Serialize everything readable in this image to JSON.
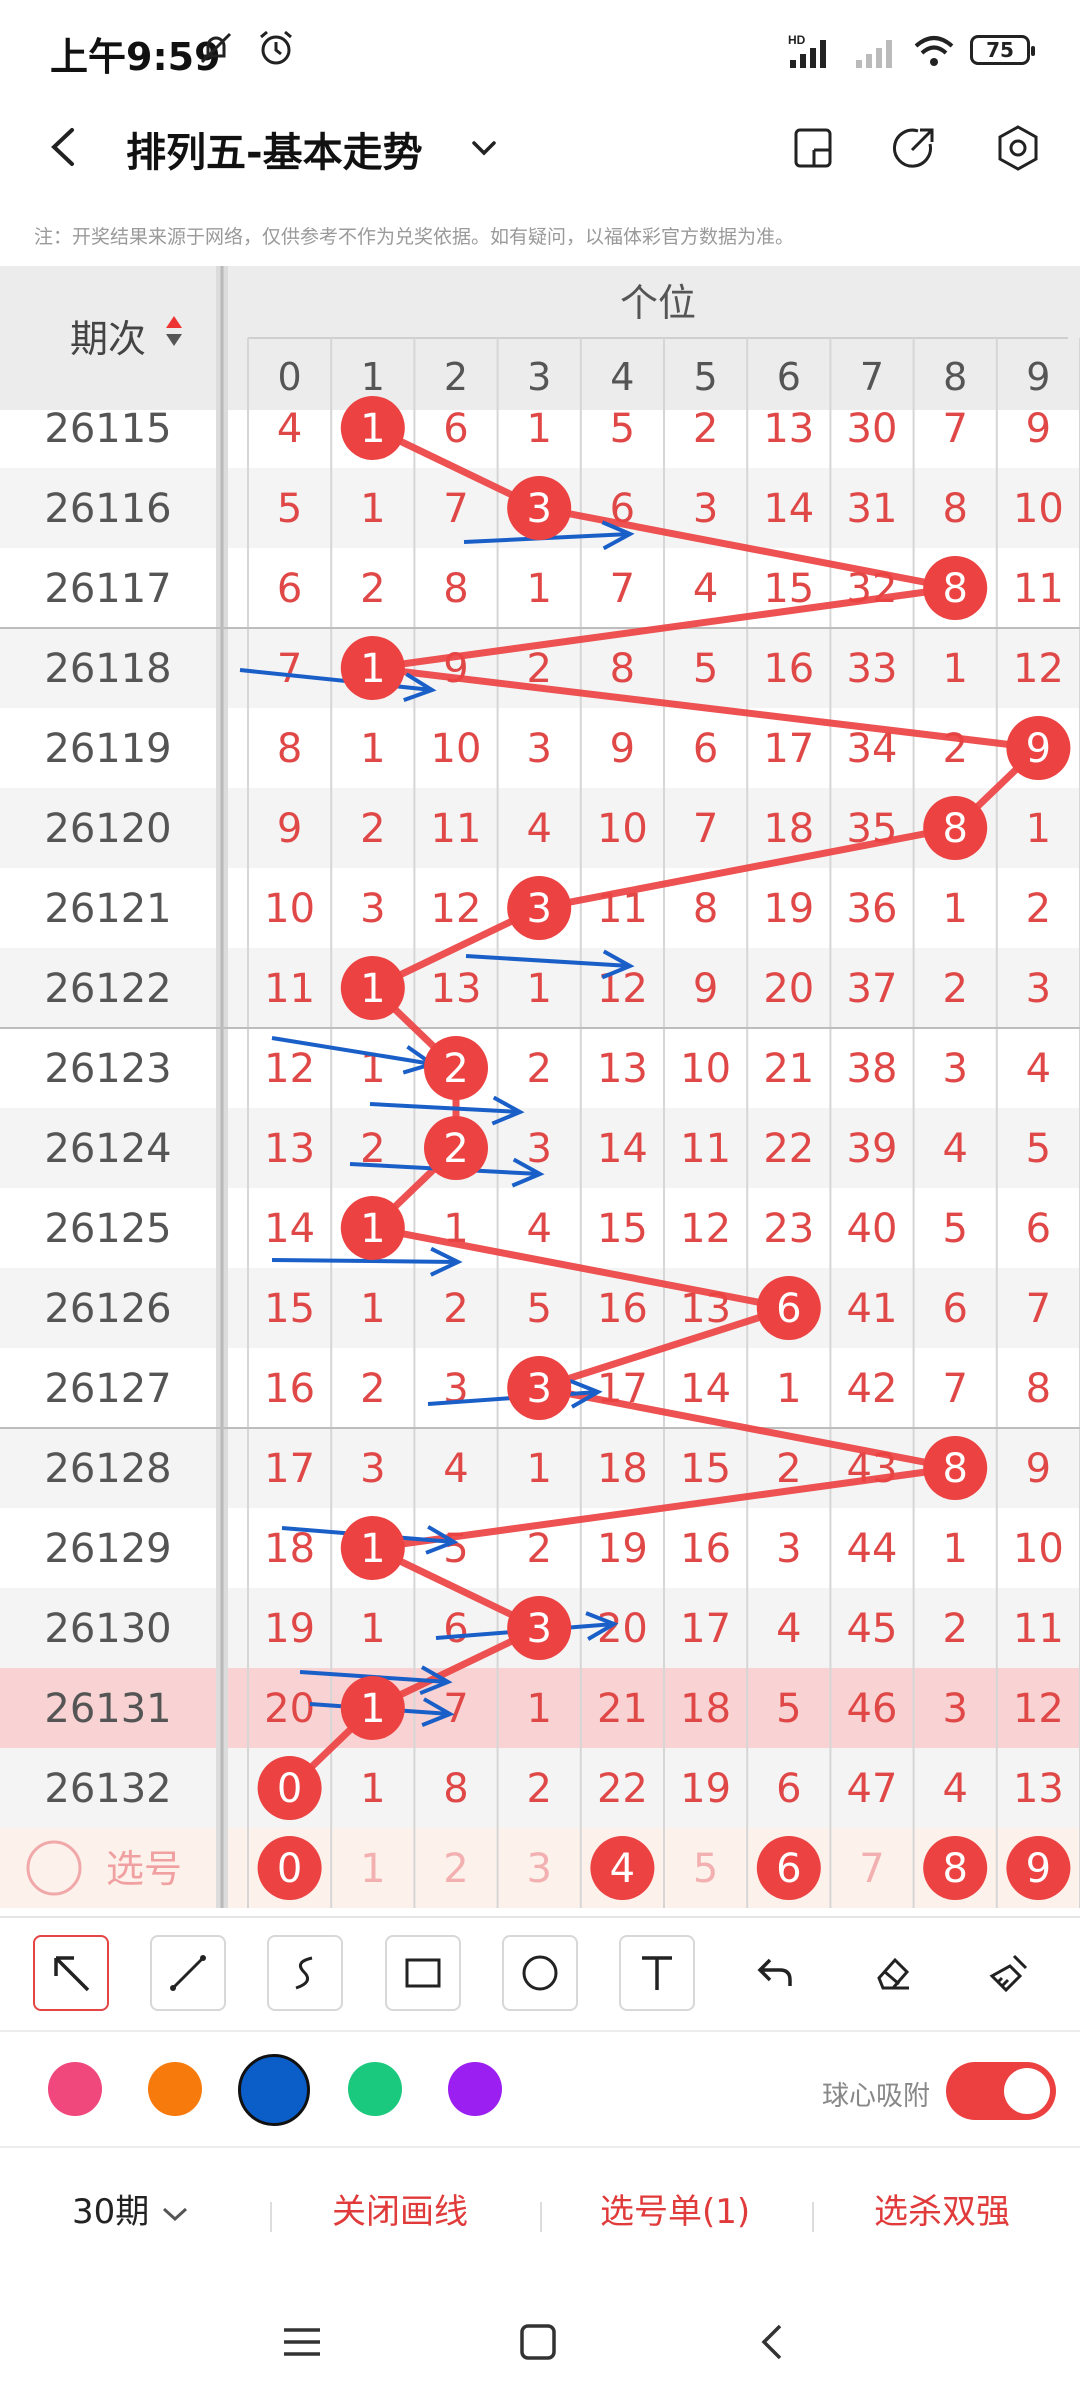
{
  "status": {
    "time": "上午9:59",
    "battery": "75",
    "network_label": "HD"
  },
  "header": {
    "title": "排列五-基本走势"
  },
  "note": "注：开奖结果来源于网络，仅供参考不作为兑奖依据。如有疑问，以福体彩官方数据为准。",
  "table": {
    "period_header": "期次",
    "group_header": "个位",
    "digit_headers": [
      "0",
      "1",
      "2",
      "3",
      "4",
      "5",
      "6",
      "7",
      "8",
      "9"
    ],
    "rows": [
      {
        "period": "26115",
        "cells": [
          "4",
          "1",
          "6",
          "1",
          "5",
          "2",
          "13",
          "30",
          "7",
          "9"
        ],
        "hit": 1
      },
      {
        "period": "26116",
        "cells": [
          "5",
          "1",
          "7",
          "3",
          "6",
          "3",
          "14",
          "31",
          "8",
          "10"
        ],
        "hit": 3
      },
      {
        "period": "26117",
        "cells": [
          "6",
          "2",
          "8",
          "1",
          "7",
          "4",
          "15",
          "32",
          "8",
          "11"
        ],
        "hit": 8
      },
      {
        "period": "26118",
        "cells": [
          "7",
          "1",
          "9",
          "2",
          "8",
          "5",
          "16",
          "33",
          "1",
          "12"
        ],
        "hit": 1
      },
      {
        "period": "26119",
        "cells": [
          "8",
          "1",
          "10",
          "3",
          "9",
          "6",
          "17",
          "34",
          "2",
          "9"
        ],
        "hit": 9
      },
      {
        "period": "26120",
        "cells": [
          "9",
          "2",
          "11",
          "4",
          "10",
          "7",
          "18",
          "35",
          "8",
          "1"
        ],
        "hit": 8
      },
      {
        "period": "26121",
        "cells": [
          "10",
          "3",
          "12",
          "3",
          "11",
          "8",
          "19",
          "36",
          "1",
          "2"
        ],
        "hit": 3
      },
      {
        "period": "26122",
        "cells": [
          "11",
          "1",
          "13",
          "1",
          "12",
          "9",
          "20",
          "37",
          "2",
          "3"
        ],
        "hit": 1
      },
      {
        "period": "26123",
        "cells": [
          "12",
          "1",
          "2",
          "2",
          "13",
          "10",
          "21",
          "38",
          "3",
          "4"
        ],
        "hit": 2
      },
      {
        "period": "26124",
        "cells": [
          "13",
          "2",
          "2",
          "3",
          "14",
          "11",
          "22",
          "39",
          "4",
          "5"
        ],
        "hit": 2
      },
      {
        "period": "26125",
        "cells": [
          "14",
          "1",
          "1",
          "4",
          "15",
          "12",
          "23",
          "40",
          "5",
          "6"
        ],
        "hit": 1
      },
      {
        "period": "26126",
        "cells": [
          "15",
          "1",
          "2",
          "5",
          "16",
          "13",
          "6",
          "41",
          "6",
          "7"
        ],
        "hit": 6
      },
      {
        "period": "26127",
        "cells": [
          "16",
          "2",
          "3",
          "3",
          "17",
          "14",
          "1",
          "42",
          "7",
          "8"
        ],
        "hit": 3
      },
      {
        "period": "26128",
        "cells": [
          "17",
          "3",
          "4",
          "1",
          "18",
          "15",
          "2",
          "43",
          "8",
          "9"
        ],
        "hit": 8
      },
      {
        "period": "26129",
        "cells": [
          "18",
          "1",
          "5",
          "2",
          "19",
          "16",
          "3",
          "44",
          "1",
          "10"
        ],
        "hit": 1
      },
      {
        "period": "26130",
        "cells": [
          "19",
          "1",
          "6",
          "3",
          "20",
          "17",
          "4",
          "45",
          "2",
          "11"
        ],
        "hit": 3
      },
      {
        "period": "26131",
        "cells": [
          "20",
          "1",
          "7",
          "1",
          "21",
          "18",
          "5",
          "46",
          "3",
          "12"
        ],
        "hit": 1
      },
      {
        "period": "26132",
        "cells": [
          "0",
          "1",
          "8",
          "2",
          "22",
          "19",
          "6",
          "47",
          "4",
          "13"
        ],
        "hit": 0
      }
    ],
    "select_label": "选号",
    "select_row": [
      "0",
      "1",
      "2",
      "3",
      "4",
      "5",
      "6",
      "7",
      "8",
      "9"
    ],
    "selected_digits": [
      0,
      4,
      6,
      8,
      9
    ],
    "highlight_row": 16
  },
  "colors": {
    "red": "#ec4242",
    "blue": "#1a5fc8",
    "swatches": [
      "#f0477d",
      "#f77b0c",
      "#0b5dc7",
      "#1bc97e",
      "#9a1ff0"
    ]
  },
  "toolbar": [
    "arrow-tool",
    "line-tool",
    "curve-tool",
    "rect-tool",
    "circle-tool",
    "text-tool",
    "undo",
    "eraser",
    "clear"
  ],
  "snap_label": "球心吸附",
  "bottom": {
    "periods": "30期",
    "close_lines": "关闭画线",
    "selection": "选号单(1)",
    "filter": "选杀双强"
  }
}
